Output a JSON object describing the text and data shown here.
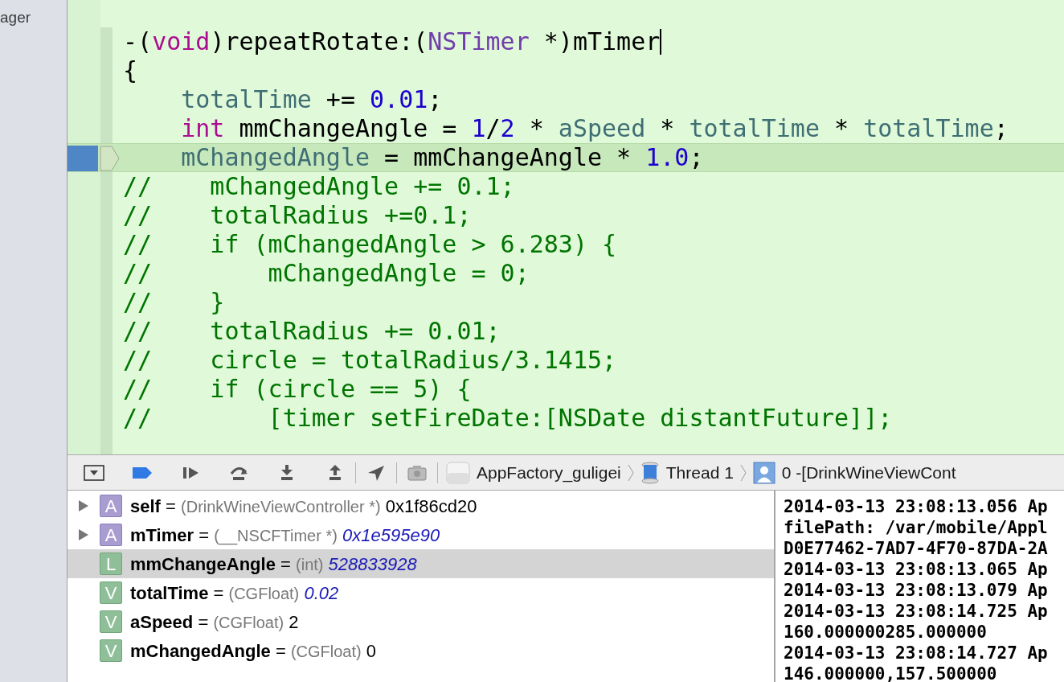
{
  "sidebar": {
    "label": "ager"
  },
  "editor": {
    "lines": [
      {
        "current": false,
        "caret": true,
        "tokens": [
          {
            "kind": "plain",
            "t": "-("
          },
          {
            "kind": "keyword",
            "t": "void"
          },
          {
            "kind": "plain",
            "t": ")repeatRotate:("
          },
          {
            "kind": "type",
            "t": "NSTimer"
          },
          {
            "kind": "plain",
            "t": " *)mTimer"
          }
        ]
      },
      {
        "current": false,
        "caret": false,
        "tokens": [
          {
            "kind": "plain",
            "t": "{"
          }
        ]
      },
      {
        "current": false,
        "caret": false,
        "tokens": [
          {
            "kind": "ivar",
            "t": "    totalTime"
          },
          {
            "kind": "plain",
            "t": " += "
          },
          {
            "kind": "number",
            "t": "0.01"
          },
          {
            "kind": "plain",
            "t": ";"
          }
        ]
      },
      {
        "current": false,
        "caret": false,
        "tokens": [
          {
            "kind": "keyword",
            "t": "    int"
          },
          {
            "kind": "plain",
            "t": " mmChangeAngle = "
          },
          {
            "kind": "number",
            "t": "1"
          },
          {
            "kind": "plain",
            "t": "/"
          },
          {
            "kind": "number",
            "t": "2"
          },
          {
            "kind": "plain",
            "t": " * "
          },
          {
            "kind": "ivar",
            "t": "aSpeed"
          },
          {
            "kind": "plain",
            "t": " * "
          },
          {
            "kind": "ivar",
            "t": "totalTime"
          },
          {
            "kind": "plain",
            "t": " * "
          },
          {
            "kind": "ivar",
            "t": "totalTime"
          },
          {
            "kind": "plain",
            "t": ";"
          }
        ]
      },
      {
        "current": true,
        "caret": false,
        "tokens": [
          {
            "kind": "ivar",
            "t": "    mChangedAngle"
          },
          {
            "kind": "plain",
            "t": " = mmChangeAngle * "
          },
          {
            "kind": "number",
            "t": "1.0"
          },
          {
            "kind": "plain",
            "t": ";"
          }
        ]
      },
      {
        "current": false,
        "caret": false,
        "tokens": [
          {
            "kind": "comment",
            "t": "//    mChangedAngle += 0.1;"
          }
        ]
      },
      {
        "current": false,
        "caret": false,
        "tokens": [
          {
            "kind": "comment",
            "t": "//    totalRadius +=0.1;"
          }
        ]
      },
      {
        "current": false,
        "caret": false,
        "tokens": [
          {
            "kind": "comment",
            "t": "//    if (mChangedAngle > 6.283) {"
          }
        ]
      },
      {
        "current": false,
        "caret": false,
        "tokens": [
          {
            "kind": "comment",
            "t": "//        mChangedAngle = 0;"
          }
        ]
      },
      {
        "current": false,
        "caret": false,
        "tokens": [
          {
            "kind": "comment",
            "t": "//    }"
          }
        ]
      },
      {
        "current": false,
        "caret": false,
        "tokens": [
          {
            "kind": "comment",
            "t": "//    totalRadius += 0.01;"
          }
        ]
      },
      {
        "current": false,
        "caret": false,
        "tokens": [
          {
            "kind": "comment",
            "t": "//    circle = totalRadius/3.1415;"
          }
        ]
      },
      {
        "current": false,
        "caret": false,
        "tokens": [
          {
            "kind": "comment",
            "t": "//    if (circle == 5) {"
          }
        ]
      },
      {
        "current": false,
        "caret": false,
        "tokens": [
          {
            "kind": "comment",
            "t": "//        [timer setFireDate:[NSDate distantFuture]];"
          }
        ]
      }
    ]
  },
  "debug_bar": {
    "breadcrumbs": [
      {
        "kind": "app",
        "label": "AppFactory_guligei"
      },
      {
        "kind": "thread",
        "label": "Thread 1"
      },
      {
        "kind": "frame",
        "label": "0 -[DrinkWineViewCont"
      }
    ]
  },
  "variables": [
    {
      "kind": "argument",
      "badge": "A",
      "expandable": true,
      "selected": false,
      "changed": false,
      "name": "self",
      "operator": "=",
      "type": "(DrinkWineViewController *)",
      "value": "0x1f86cd20"
    },
    {
      "kind": "argument",
      "badge": "A",
      "expandable": true,
      "selected": false,
      "changed": true,
      "name": "mTimer",
      "operator": "=",
      "type": "(__NSCFTimer *)",
      "value": "0x1e595e90"
    },
    {
      "kind": "local",
      "badge": "L",
      "expandable": false,
      "selected": true,
      "changed": true,
      "name": "mmChangeAngle",
      "operator": "=",
      "type": "(int)",
      "value": "528833928"
    },
    {
      "kind": "variable",
      "badge": "V",
      "expandable": false,
      "selected": false,
      "changed": true,
      "name": "totalTime",
      "operator": "=",
      "type": "(CGFloat)",
      "value": "0.02"
    },
    {
      "kind": "variable",
      "badge": "V",
      "expandable": false,
      "selected": false,
      "changed": false,
      "name": "aSpeed",
      "operator": "=",
      "type": "(CGFloat)",
      "value": "2"
    },
    {
      "kind": "variable",
      "badge": "V",
      "expandable": false,
      "selected": false,
      "changed": false,
      "name": "mChangedAngle",
      "operator": "=",
      "type": "(CGFloat)",
      "value": "0"
    }
  ],
  "console": {
    "lines": [
      "2014-03-13 23:08:13.056 Ap",
      "filePath: /var/mobile/Appl",
      "D0E77462-7AD7-4F70-87DA-2A",
      "2014-03-13 23:08:13.065 Ap",
      "2014-03-13 23:08:13.079 Ap",
      "2014-03-13 23:08:14.725 Ap",
      "160.000000285.000000",
      "2014-03-13 23:08:14.727 Ap",
      "146.000000,157.500000"
    ]
  }
}
